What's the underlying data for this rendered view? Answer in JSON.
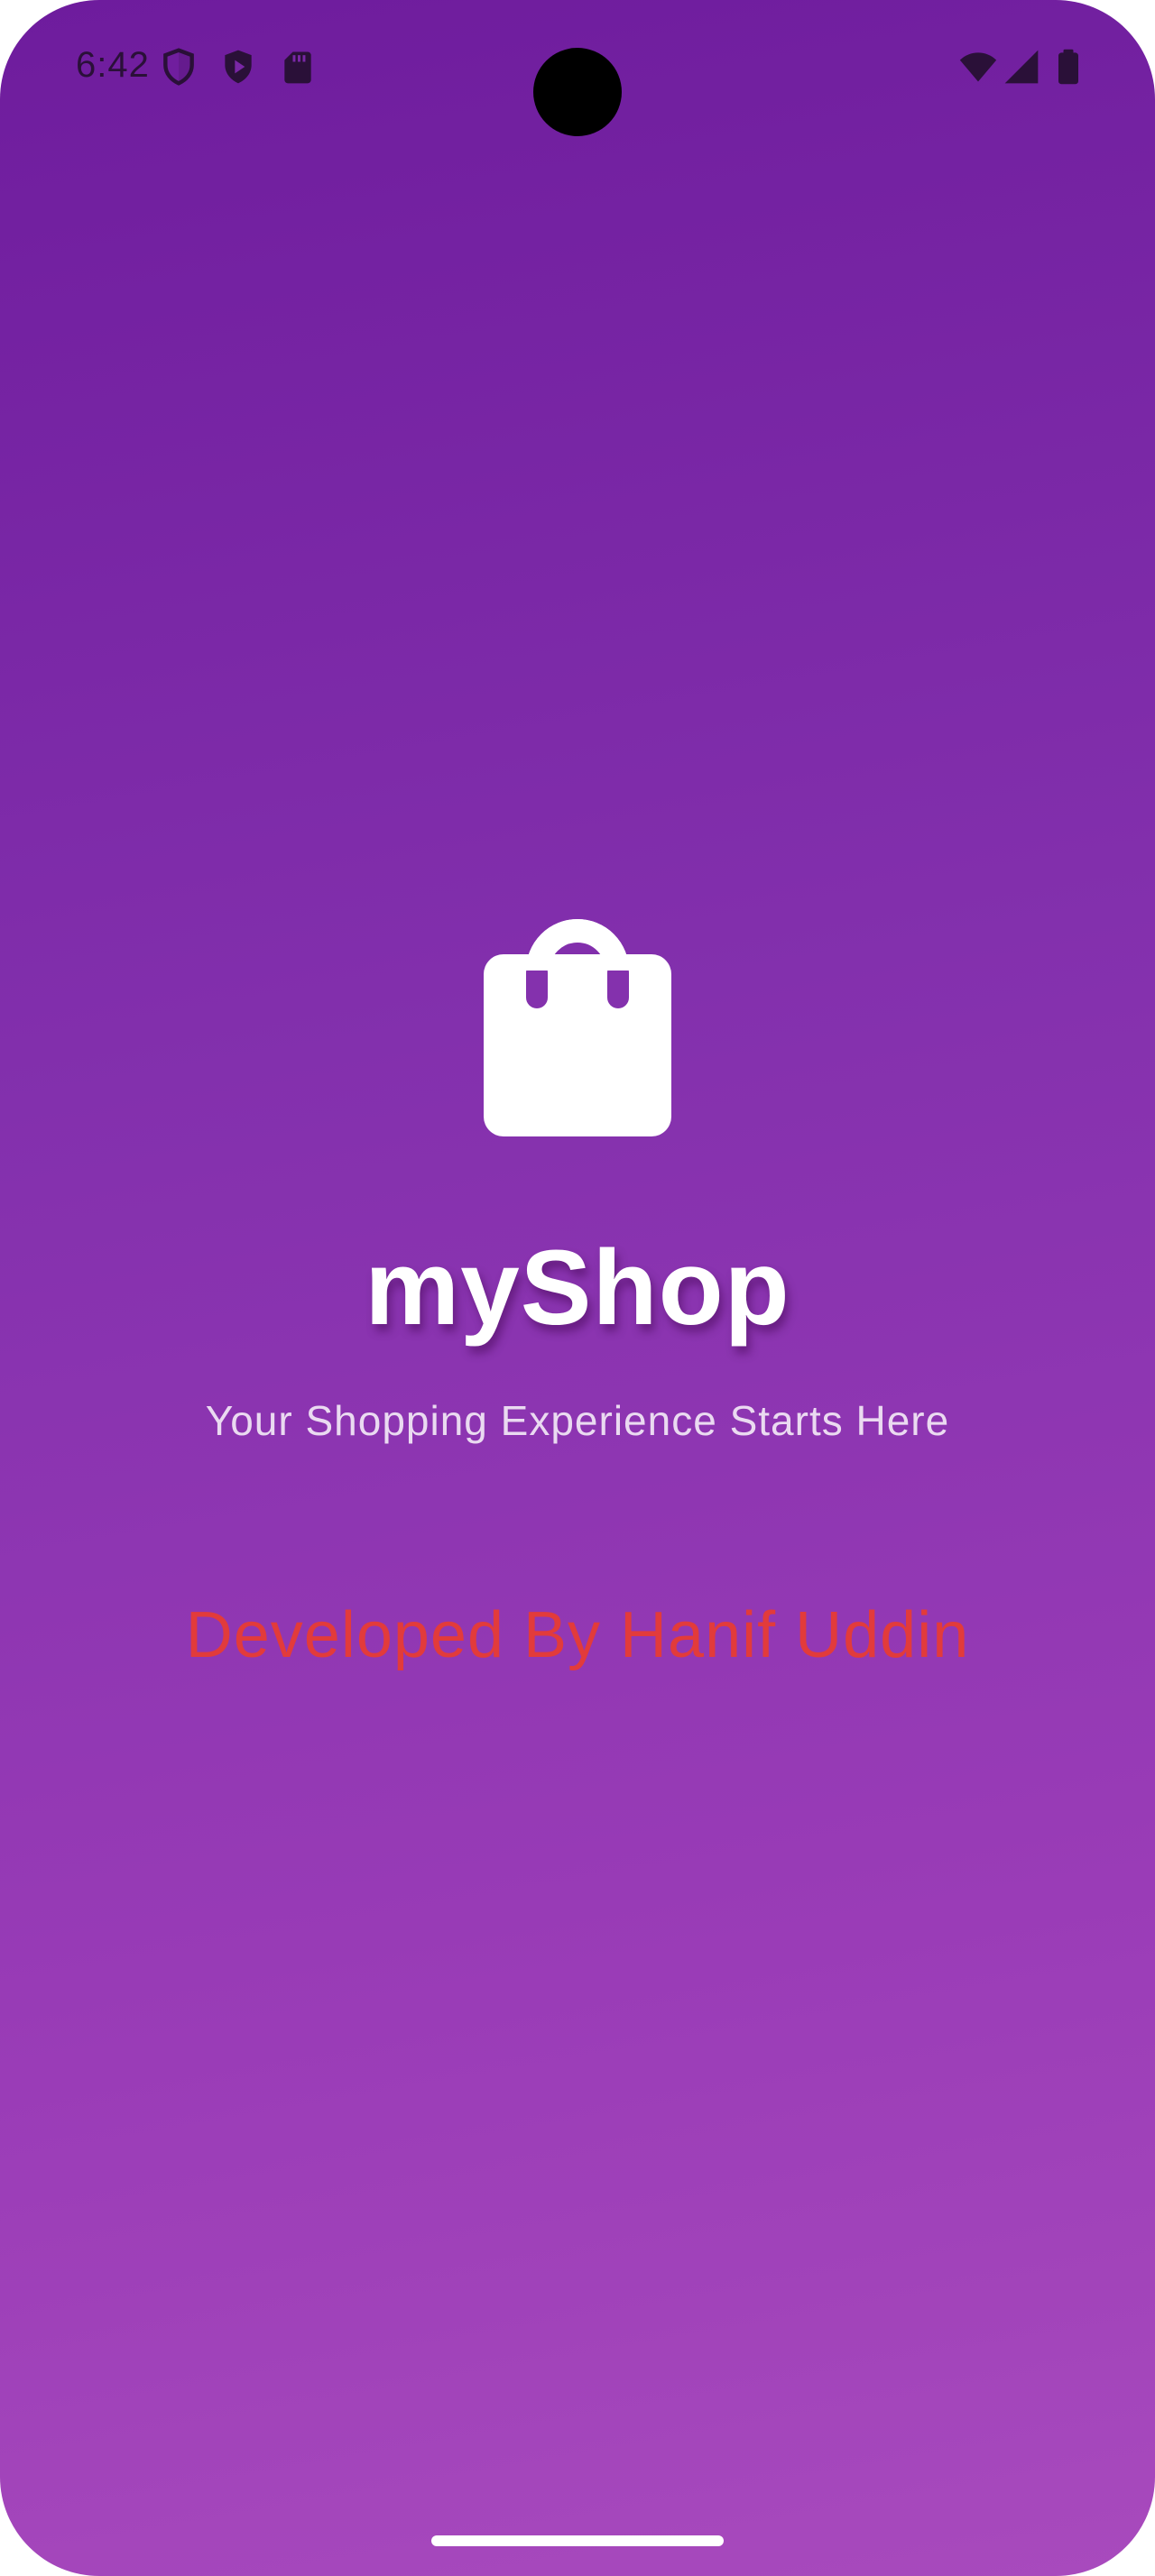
{
  "status_bar": {
    "time": "6:42",
    "left_icons": [
      "shield-icon",
      "play-protect-icon",
      "sd-card-icon"
    ],
    "right_icons": [
      "wifi-icon",
      "cellular-signal-icon",
      "battery-icon"
    ]
  },
  "splash": {
    "logo_icon": "shopping-bag-icon",
    "title": "myShop",
    "tagline": "Your Shopping Experience Starts Here",
    "developer_credit": "Developed By Hanif Uddin"
  },
  "colors": {
    "gradient_top": "#6e1c9d",
    "gradient_bottom": "#a84abd",
    "title": "#ffffff",
    "credit": "#e23b3b"
  }
}
